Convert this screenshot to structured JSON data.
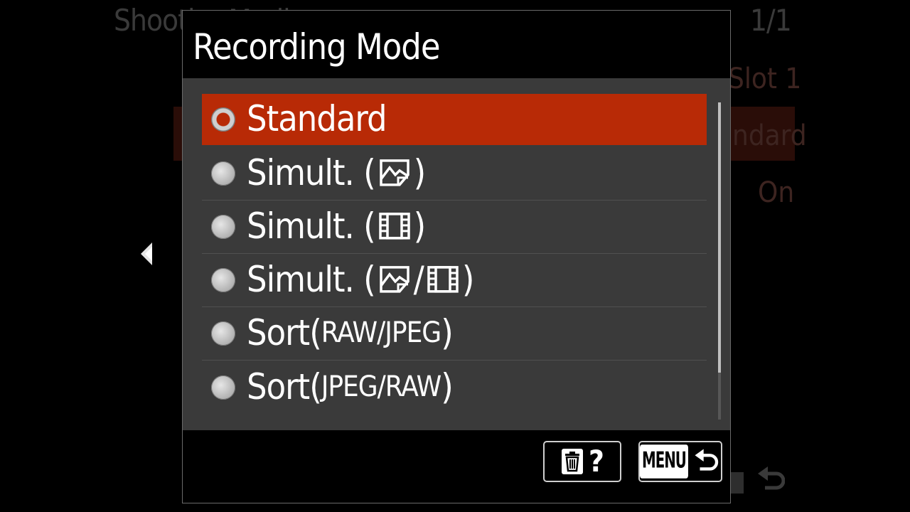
{
  "background_menu": {
    "title": "Shooti… Media…",
    "page_indicator": "1/1",
    "value_slot": "Slot 1",
    "value_mode": "ndard",
    "value_on": "On"
  },
  "dialog": {
    "title": "Recording Mode",
    "options": [
      {
        "label": "Standard",
        "selected": true
      },
      {
        "label": "Simult. (",
        "icon": "still-image-icon",
        "suffix": ")"
      },
      {
        "label": "Simult. (",
        "icon": "movie-icon",
        "suffix": ")"
      },
      {
        "label": "Simult. (",
        "icon": "still-image-icon",
        "sep": "/",
        "icon2": "movie-icon",
        "suffix": ")"
      },
      {
        "label": "Sort(",
        "sub": "RAW/JPEG",
        "suffix": ")"
      },
      {
        "label": "Sort(",
        "sub": "JPEG/RAW",
        "suffix": ")"
      }
    ],
    "footer": {
      "help_label": "?",
      "menu_label": "MENU"
    }
  },
  "colors": {
    "selection": "#b82a06",
    "panel": "#3a3a3a",
    "background": "#000000"
  }
}
